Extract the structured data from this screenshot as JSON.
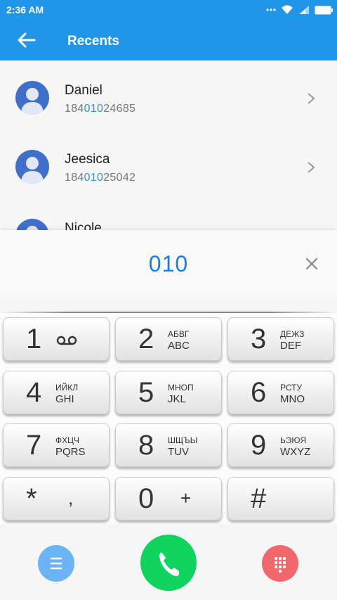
{
  "status_bar": {
    "time": "2:36 AM",
    "icons": [
      "dots-icon",
      "wifi-icon",
      "signal-icon",
      "battery-icon"
    ]
  },
  "app_bar": {
    "title": "Recents",
    "back_icon": "arrow-left-icon"
  },
  "contacts": [
    {
      "name": "Daniel",
      "number_prefix": "184",
      "number_match": "010",
      "number_suffix": "24685"
    },
    {
      "name": "Jeesica",
      "number_prefix": "184",
      "number_match": "010",
      "number_suffix": "25042"
    },
    {
      "name": "Nicole"
    }
  ],
  "dialer": {
    "entered_number": "010",
    "clear_icon": "close-icon"
  },
  "keypad": [
    {
      "digit": "1",
      "letters_cyrillic": "",
      "letters_latin": "",
      "icon": "voicemail-icon"
    },
    {
      "digit": "2",
      "letters_cyrillic": "АБВГ",
      "letters_latin": "ABC"
    },
    {
      "digit": "3",
      "letters_cyrillic": "ДЕЖЗ",
      "letters_latin": "DEF"
    },
    {
      "digit": "4",
      "letters_cyrillic": "ИЙКЛ",
      "letters_latin": "GHI"
    },
    {
      "digit": "5",
      "letters_cyrillic": "МНОП",
      "letters_latin": "JKL"
    },
    {
      "digit": "6",
      "letters_cyrillic": "РСТУ",
      "letters_latin": "MNO"
    },
    {
      "digit": "7",
      "letters_cyrillic": "ФХЦЧ",
      "letters_latin": "PQRS"
    },
    {
      "digit": "8",
      "letters_cyrillic": "ШЩЪЫ",
      "letters_latin": "TUV"
    },
    {
      "digit": "9",
      "letters_cyrillic": "ЬЭЮЯ",
      "letters_latin": "WXYZ"
    },
    {
      "digit": "*",
      "secondary": ","
    },
    {
      "digit": "0",
      "secondary": "+"
    },
    {
      "digit": "#",
      "secondary": ""
    }
  ],
  "bottom_actions": {
    "menu_icon": "menu-icon",
    "call_icon": "phone-icon",
    "dialpad_icon": "dialpad-icon"
  },
  "colors": {
    "primary": "#2196e8",
    "number_highlight": "#2196e8",
    "call_green": "#11d35f",
    "menu_blue": "#6ab3f5",
    "dialpad_red": "#f1676b",
    "avatar_blue": "#3f6fc9"
  }
}
